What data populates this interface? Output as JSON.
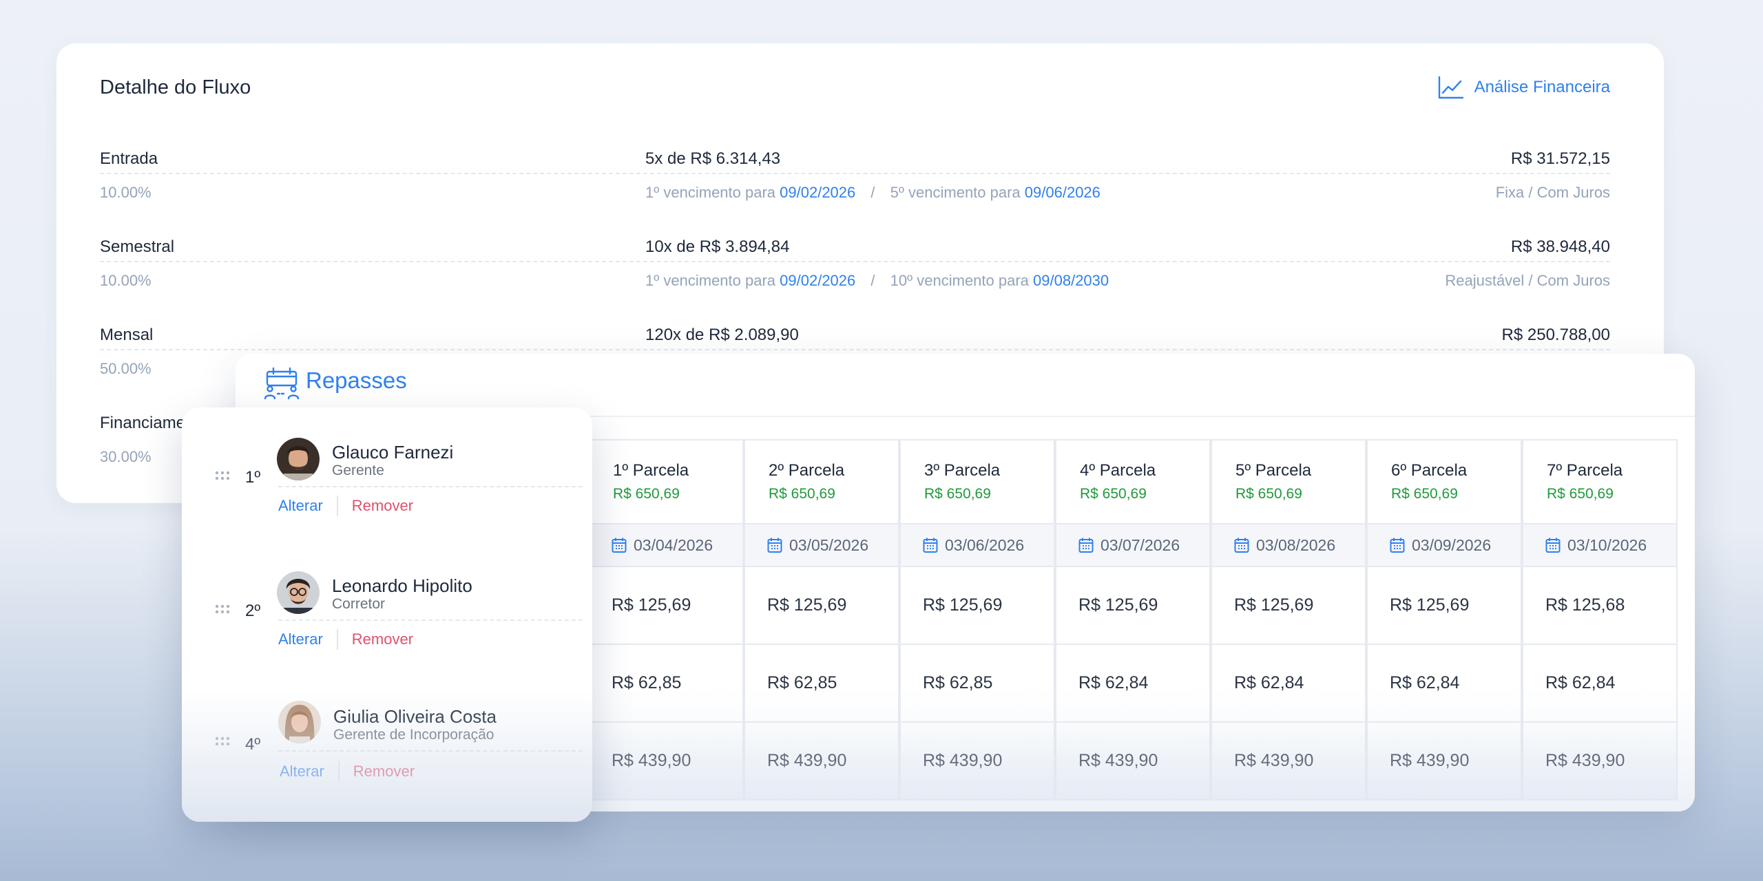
{
  "fluxo": {
    "title": "Detalhe do Fluxo",
    "link_label": "Análise Financeira",
    "link_icon": "line-chart-icon",
    "rows": [
      {
        "name": "Entrada",
        "installments": "5x de R$ 6.314,43",
        "total": "R$ 31.572,15",
        "percent": "10.00%",
        "first_label": "1º vencimento para",
        "first_date": "09/02/2026",
        "last_label": "5º vencimento para",
        "last_date": "09/06/2026",
        "type": "Fixa / Com Juros"
      },
      {
        "name": "Semestral",
        "installments": "10x de R$ 3.894,84",
        "total": "R$ 38.948,40",
        "percent": "10.00%",
        "first_label": "1º vencimento para",
        "first_date": "09/02/2026",
        "last_label": "10º vencimento para",
        "last_date": "09/08/2030",
        "type": "Reajustável / Com Juros"
      },
      {
        "name": "Mensal",
        "installments": "120x de R$ 2.089,90",
        "total": "R$ 250.788,00",
        "percent": "50.00%"
      },
      {
        "name": "Financiamento",
        "percent": "30.00%"
      }
    ],
    "separator": "/"
  },
  "repasses": {
    "title": "Repasses",
    "icon": "calendar-people-icon",
    "columns": [
      {
        "parcela": "1º Parcela",
        "valor": "R$ 650,69",
        "date": "03/04/2026",
        "amounts": [
          "R$ 125,69",
          "R$ 62,85",
          "R$ 439,90"
        ]
      },
      {
        "parcela": "2º Parcela",
        "valor": "R$ 650,69",
        "date": "03/05/2026",
        "amounts": [
          "R$ 125,69",
          "R$ 62,85",
          "R$ 439,90"
        ]
      },
      {
        "parcela": "3º Parcela",
        "valor": "R$ 650,69",
        "date": "03/06/2026",
        "amounts": [
          "R$ 125,69",
          "R$ 62,85",
          "R$ 439,90"
        ]
      },
      {
        "parcela": "4º Parcela",
        "valor": "R$ 650,69",
        "date": "03/07/2026",
        "amounts": [
          "R$ 125,69",
          "R$ 62,84",
          "R$ 439,90"
        ]
      },
      {
        "parcela": "5º Parcela",
        "valor": "R$ 650,69",
        "date": "03/08/2026",
        "amounts": [
          "R$ 125,69",
          "R$ 62,84",
          "R$ 439,90"
        ]
      },
      {
        "parcela": "6º Parcela",
        "valor": "R$ 650,69",
        "date": "03/09/2026",
        "amounts": [
          "R$ 125,69",
          "R$ 62,84",
          "R$ 439,90"
        ]
      },
      {
        "parcela": "7º Parcela",
        "valor": "R$ 650,69",
        "date": "03/10/2026",
        "amounts": [
          "R$ 125,68",
          "R$ 62,84",
          "R$ 439,90"
        ]
      }
    ]
  },
  "people": [
    {
      "order": "1º",
      "name": "Glauco Farnezi",
      "role": "Gerente",
      "alter": "Alterar",
      "remove": "Remover"
    },
    {
      "order": "2º",
      "name": "Leonardo Hipolito",
      "role": "Corretor",
      "alter": "Alterar",
      "remove": "Remover"
    },
    {
      "order": "4º",
      "name": "Giulia Oliveira Costa",
      "role": "Gerente de Incorporação",
      "alter": "Alterar",
      "remove": "Remover"
    }
  ],
  "colors": {
    "accent": "#2f80ed",
    "positive": "#1f9a3a",
    "danger": "#e0506b",
    "muted": "#94a3b8"
  }
}
